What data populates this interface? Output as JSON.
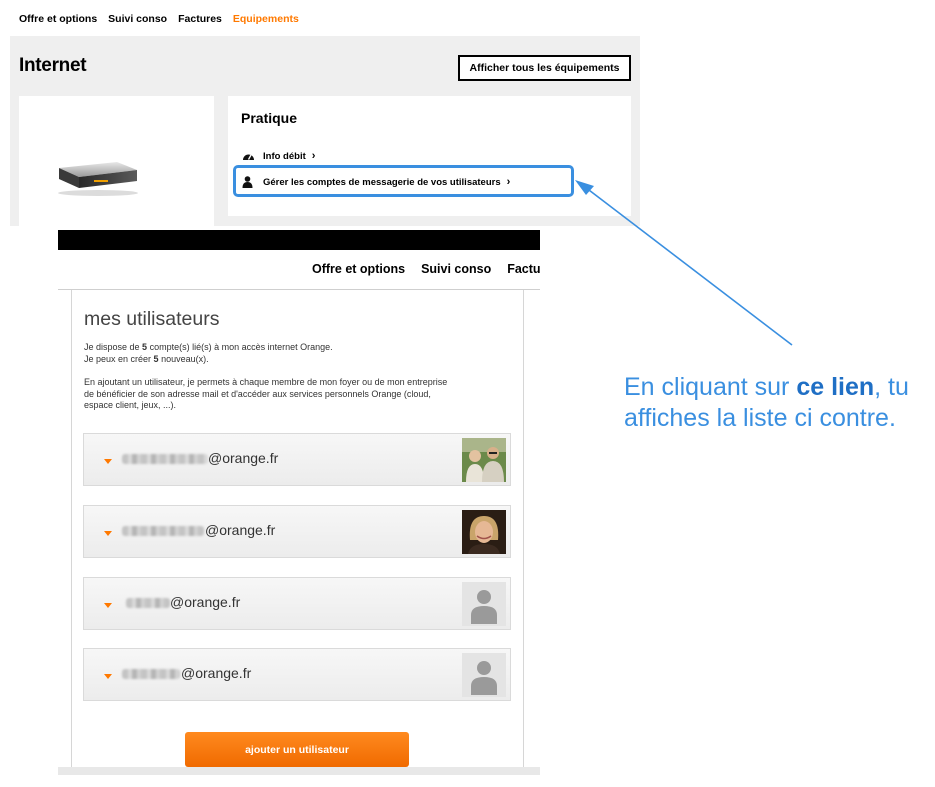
{
  "top_nav": {
    "items": [
      "Offre et options",
      "Suivi conso",
      "Factures"
    ],
    "active": "Equipements",
    "active_color": "#ff7900"
  },
  "equipment": {
    "title": "Internet",
    "show_all_button": "Afficher tous les équipements",
    "device_image": "livebox-router-image"
  },
  "pratique": {
    "title": "Pratique",
    "links": [
      {
        "label": "Info débit",
        "icon": "speedometer-icon"
      },
      {
        "label": "Gérer les comptes de messagerie de vos utilisateurs",
        "icon": "user-icon"
      }
    ]
  },
  "users_page": {
    "nav": [
      "Offre et options",
      "Suivi conso",
      "Factu"
    ],
    "title": "mes utilisateurs",
    "line1_pre": "Je dispose de ",
    "line1_count": "5",
    "line1_post": " compte(s) lié(s) à mon accès internet Orange.",
    "line2_pre": "Je peux en créer ",
    "line2_count": "5",
    "line2_post": " nouveau(x).",
    "paragraph_lines": [
      "En ajoutant un utilisateur, je permets à chaque membre de mon foyer ou de mon entreprise",
      "de bénéficier de son adresse mail et d'accéder aux services personnels Orange (cloud,",
      "espace client, jeux, ...)."
    ],
    "users": [
      {
        "domain": "@orange.fr",
        "avatar": "photo-couple"
      },
      {
        "domain": "@orange.fr",
        "avatar": "photo-woman"
      },
      {
        "domain": "@orange.fr",
        "avatar": "default-user-icon"
      },
      {
        "domain": "@orange.fr",
        "avatar": "default-user-icon"
      }
    ],
    "add_button": "ajouter un utilisateur",
    "accent_color": "#ff7900"
  },
  "annotation": {
    "pre": "En cliquant sur ",
    "bold": "ce lien",
    "post": ", tu",
    "line2": "affiches la liste ci contre.",
    "color": "#3a8fe0"
  }
}
